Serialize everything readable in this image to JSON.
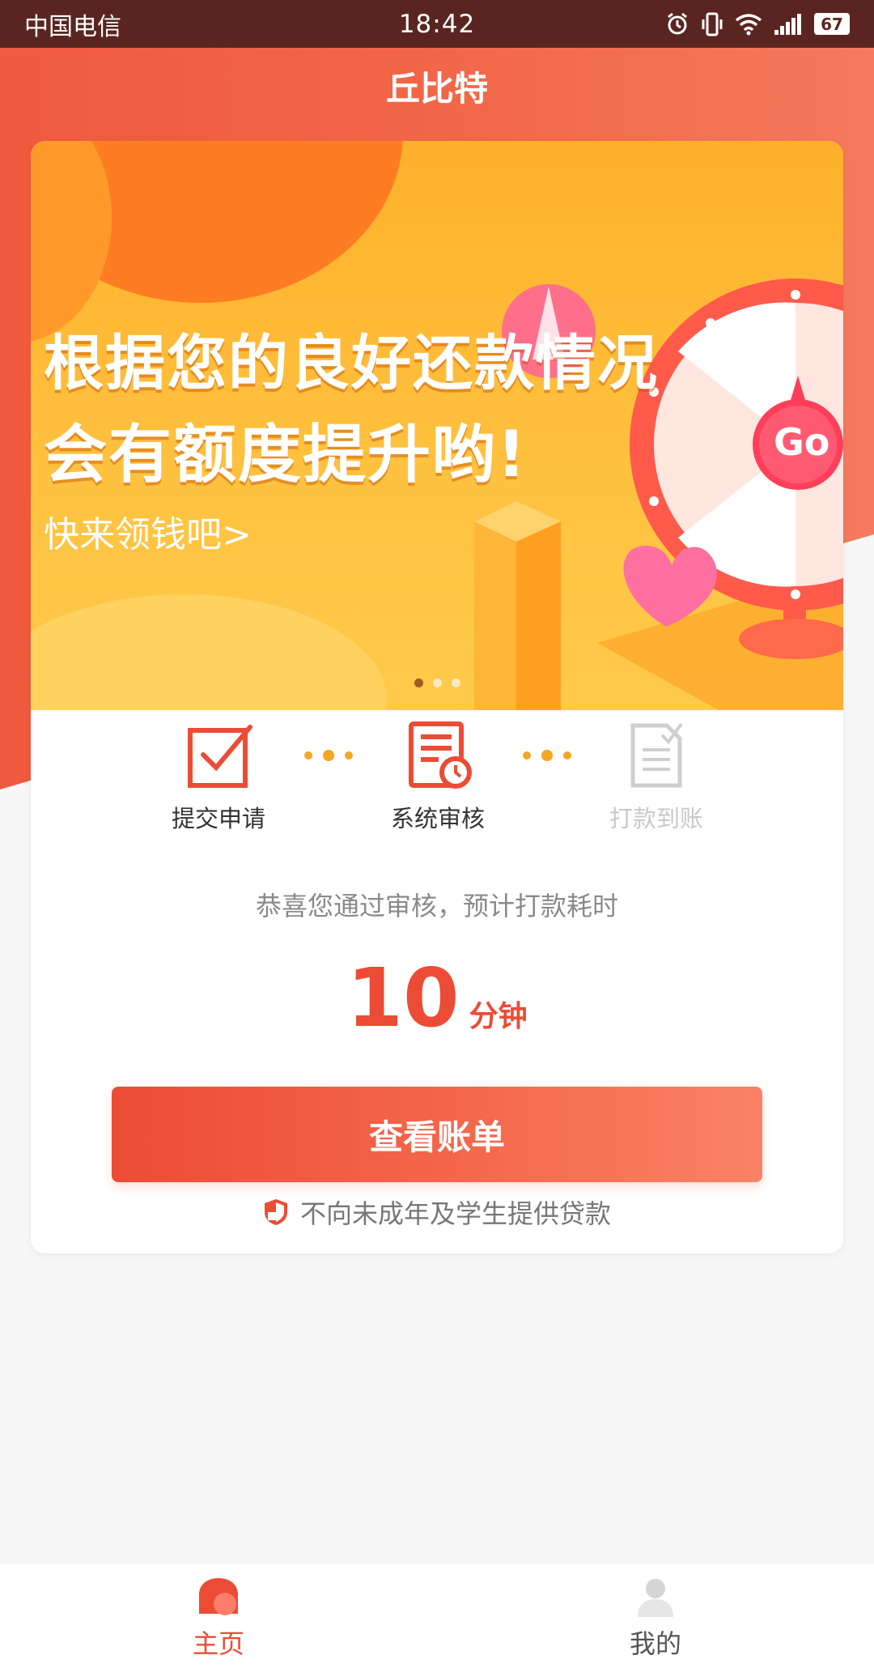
{
  "status_bar": {
    "carrier": "中国电信",
    "time": "18:42",
    "battery": "67",
    "icons": [
      "alarm-icon",
      "vibrate-icon",
      "wifi-icon",
      "signal-icon",
      "battery-icon"
    ]
  },
  "header": {
    "title": "丘比特"
  },
  "banner": {
    "line1": "根据您的良好还款情况",
    "line2": "会有额度提升哟!",
    "line3": "快来领钱吧>",
    "go_label": "Go",
    "carousel": {
      "count": 3,
      "active_index": 1
    }
  },
  "steps": [
    {
      "label": "提交申请",
      "icon": "checkbox-icon",
      "state": "done"
    },
    {
      "label": "系统审核",
      "icon": "document-clock-icon",
      "state": "current"
    },
    {
      "label": "打款到账",
      "icon": "document-check-icon",
      "state": "pending"
    }
  ],
  "review": {
    "message": "恭喜您通过审核，预计打款耗时",
    "eta_value": "10",
    "eta_unit": "分钟"
  },
  "actions": {
    "view_bill": "查看账单"
  },
  "notice": {
    "text": "不向未成年及学生提供贷款",
    "icon": "shield-icon"
  },
  "tabbar": {
    "items": [
      {
        "label": "主页",
        "icon": "home-icon",
        "active": true
      },
      {
        "label": "我的",
        "icon": "profile-icon",
        "active": false
      }
    ]
  },
  "colors": {
    "primary": "#ec4c35",
    "status_bar": "#5a2520",
    "banner": "#ffb02b",
    "accent_dot": "#f5a623"
  }
}
